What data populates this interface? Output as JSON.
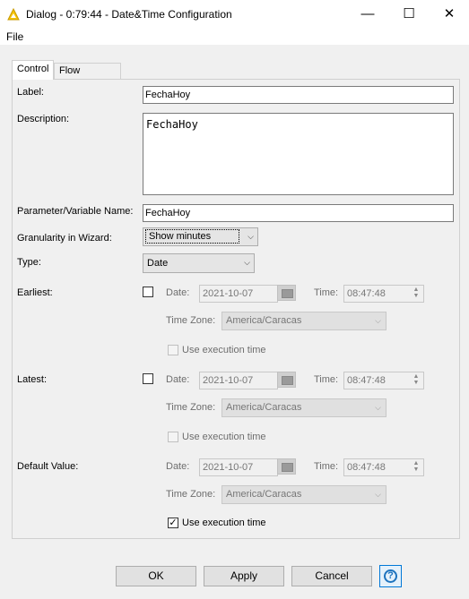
{
  "window": {
    "title": "Dialog - 0:79:44 - Date&Time Configuration",
    "icon": "knime-warning-triangle-icon",
    "controls": {
      "minimize": "—",
      "maximize": "☐",
      "close": "✕"
    }
  },
  "menu": {
    "file": "File"
  },
  "tabs": [
    {
      "label": "Control",
      "active": true
    },
    {
      "label": "Flow Variables",
      "active": false
    }
  ],
  "form": {
    "label_label": "Label:",
    "label_value": "FechaHoy",
    "description_label": "Description:",
    "description_value": "FechaHoy",
    "param_label": "Parameter/Variable Name:",
    "param_value": "FechaHoy",
    "granularity_label": "Granularity in Wizard:",
    "granularity_value": "Show minutes",
    "type_label": "Type:",
    "type_value": "Date",
    "date_label": "Date:",
    "time_label": "Time:",
    "timezone_label": "Time Zone:",
    "use_exec_label": "Use execution time",
    "earliest": {
      "label": "Earliest:",
      "checked": false,
      "date": "2021-10-07",
      "time": "08:47:48",
      "timezone": "America/Caracas",
      "use_execution_time": false
    },
    "latest": {
      "label": "Latest:",
      "checked": false,
      "date": "2021-10-07",
      "time": "08:47:48",
      "timezone": "America/Caracas",
      "use_execution_time": false
    },
    "default": {
      "label": "Default Value:",
      "date": "2021-10-07",
      "time": "08:47:48",
      "timezone": "America/Caracas",
      "use_execution_time": true
    }
  },
  "buttons": {
    "ok": "OK",
    "apply": "Apply",
    "cancel": "Cancel",
    "help": "?"
  },
  "colors": {
    "accent": "#0078d7",
    "help_icon": "#1e73be"
  }
}
